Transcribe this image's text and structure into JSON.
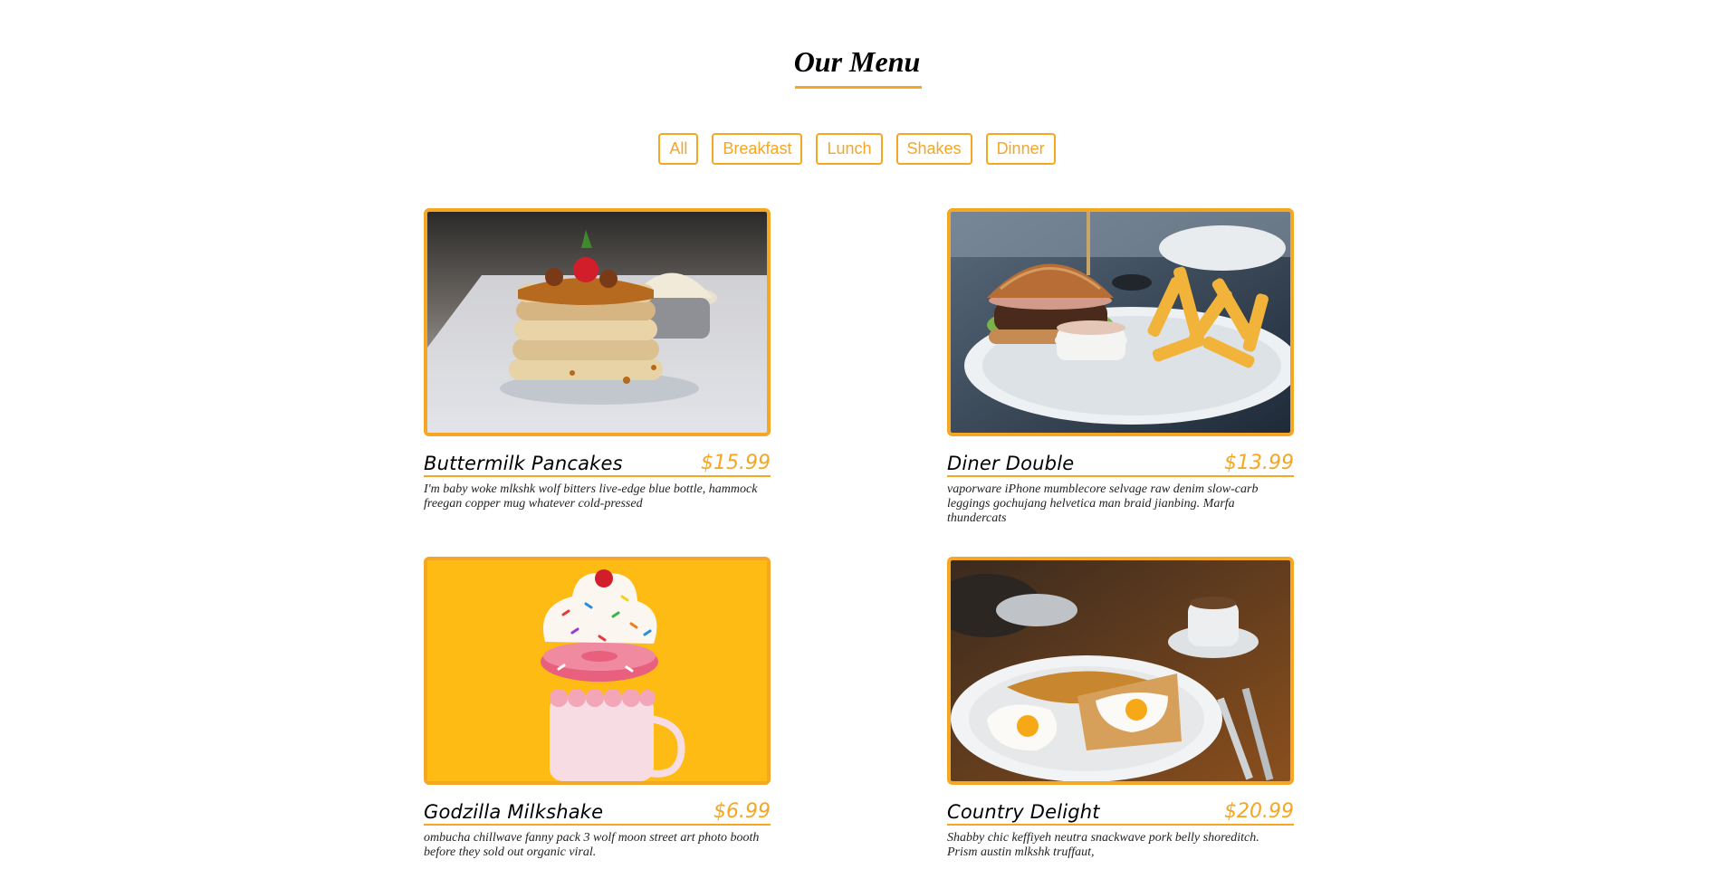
{
  "section": {
    "title": "Our Menu"
  },
  "filters": [
    {
      "label": "All"
    },
    {
      "label": "Breakfast"
    },
    {
      "label": "Lunch"
    },
    {
      "label": "Shakes"
    },
    {
      "label": "Dinner"
    }
  ],
  "colors": {
    "accent": "#f5a623",
    "text": "#000000"
  },
  "items": [
    {
      "name": "Buttermilk Pancakes",
      "price": "$15.99",
      "description": "I'm baby woke mlkshk wolf bitters live-edge blue bottle, hammock freegan copper mug whatever cold-pressed",
      "photo": "pancakes-photo"
    },
    {
      "name": "Diner Double",
      "price": "$13.99",
      "description": "vaporware iPhone mumblecore selvage raw denim slow-carb leggings gochujang helvetica man braid jianbing. Marfa thundercats",
      "photo": "burger-photo"
    },
    {
      "name": "Godzilla Milkshake",
      "price": "$6.99",
      "description": "ombucha chillwave fanny pack 3 wolf moon street art photo booth before they sold out organic viral.",
      "photo": "milkshake-photo"
    },
    {
      "name": "Country Delight",
      "price": "$20.99",
      "description": "Shabby chic keffiyeh neutra snackwave pork belly shoreditch. Prism austin mlkshk truffaut,",
      "photo": "eggs-toast-photo"
    }
  ]
}
